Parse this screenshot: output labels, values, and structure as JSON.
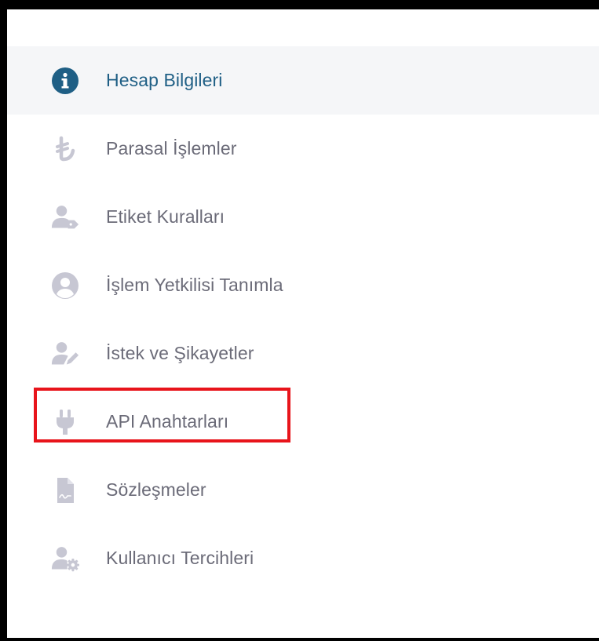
{
  "menu": {
    "items": [
      {
        "label": "Hesap Bilgileri",
        "icon": "info-circle-icon",
        "active": true
      },
      {
        "label": "Parasal İşlemler",
        "icon": "turkish-lira-icon",
        "active": false
      },
      {
        "label": "Etiket Kuralları",
        "icon": "user-tag-icon",
        "active": false
      },
      {
        "label": "İşlem Yetkilisi Tanımla",
        "icon": "user-circle-icon",
        "active": false
      },
      {
        "label": "İstek ve Şikayetler",
        "icon": "user-edit-icon",
        "active": false
      },
      {
        "label": "API Anahtarları",
        "icon": "plug-icon",
        "active": false,
        "highlighted": true
      },
      {
        "label": "Sözleşmeler",
        "icon": "contract-file-icon",
        "active": false
      },
      {
        "label": "Kullanıcı Tercihleri",
        "icon": "user-cog-icon",
        "active": false
      }
    ]
  },
  "colors": {
    "active_text": "#1f5f85",
    "active_icon": "#1f5f85",
    "inactive_text": "#6b6b78",
    "inactive_icon": "#c7c7d3",
    "active_background": "#f5f6f8",
    "highlight_border": "#e8141b"
  }
}
